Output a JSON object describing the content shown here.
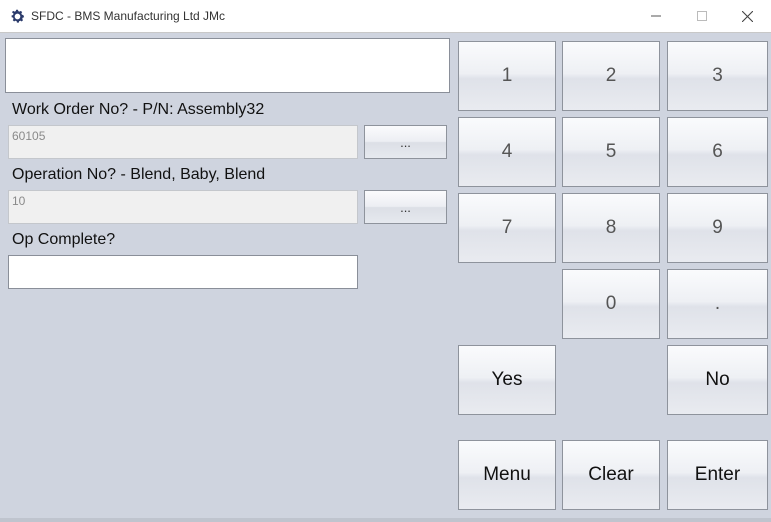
{
  "window": {
    "title": "SFDC - BMS Manufacturing Ltd JMc",
    "app_icon": "gear-icon",
    "minimize_symbol": "─",
    "maximize_symbol": "☐",
    "close_symbol": "✕"
  },
  "form": {
    "display_value": "",
    "work_order_label": "Work Order No? - P/N: Assembly32",
    "work_order_value": "60105",
    "work_order_lookup": "...",
    "operation_label": "Operation No? - Blend, Baby, Blend",
    "operation_value": "10",
    "operation_lookup": "...",
    "op_complete_label": "Op Complete?",
    "op_complete_value": ""
  },
  "keypad": {
    "keys": [
      "1",
      "2",
      "3",
      "4",
      "5",
      "6",
      "7",
      "8",
      "9",
      "0",
      "."
    ],
    "yes": "Yes",
    "no": "No",
    "menu": "Menu",
    "clear": "Clear",
    "enter": "Enter"
  }
}
